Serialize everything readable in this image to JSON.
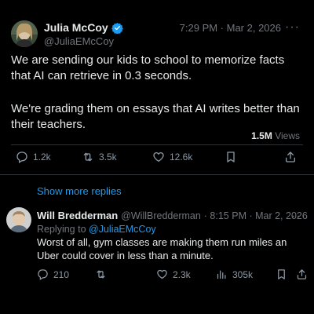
{
  "post": {
    "author_name": "Julia McCoy",
    "author_handle": "@JuliaEMcCoy",
    "timestamp": "7:29 PM · Mar 2, 2026",
    "more_menu": "···",
    "text_p1": "We are sending our kids to school to memorize facts that AI can retrieve in 0.3 seconds.",
    "text_p2": "We're grading them on essays that AI writes better than their teachers.",
    "views_count": "1.5M",
    "views_label": "Views",
    "actions": {
      "replies": "1.2k",
      "reposts": "3.5k",
      "likes": "12.6k"
    },
    "verified_color": "#1d9bf0"
  },
  "show_more_replies": "Show more replies",
  "reply": {
    "author_name": "Will Bredderman",
    "author_handle": "@WillBredderman",
    "timestamp": "· 8:15 PM · Mar 2, 2026",
    "more_menu": "···",
    "replying_to_prefix": "Replying to",
    "replying_to_handle": "@JuliaEMcCoy",
    "text": "Worst of all, gym classes are making them run miles an Uber could cover in less than a minute.",
    "actions": {
      "replies": "210",
      "likes": "2.3k",
      "views": "305k"
    }
  },
  "colors": {
    "background": "#000000",
    "text": "#e7e9ea",
    "muted": "#71767b",
    "accent": "#1d9bf0"
  }
}
